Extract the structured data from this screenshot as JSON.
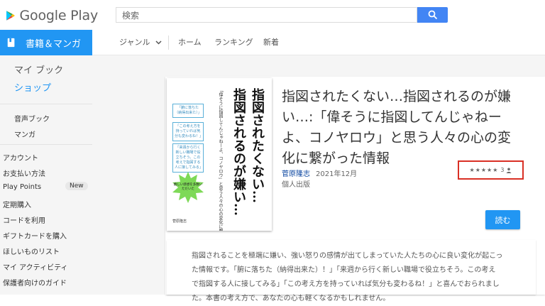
{
  "header": {
    "logo_text": "Google Play",
    "search_placeholder": "検索",
    "colors": {
      "search_button": "#4285f4"
    }
  },
  "category": {
    "label": "書籍＆マンガ",
    "icon": "book-icon",
    "color": "#2196f3"
  },
  "subnav": {
    "genre": "ジャンル",
    "home": "ホーム",
    "ranking": "ランキング",
    "new": "新着"
  },
  "sidebar": {
    "my_book": "マイ ブック",
    "shop": "ショップ",
    "audiobook": "音声ブック",
    "manga": "マンガ",
    "account_items": [
      {
        "label": "アカウント"
      },
      {
        "label": "お支払い方法"
      },
      {
        "label": "Play Points",
        "badge": "New"
      },
      {
        "label": "定期購入"
      },
      {
        "label": "コードを利用"
      },
      {
        "label": "ギフトカードを購入"
      },
      {
        "label": "ほしいものリスト"
      },
      {
        "label": "マイ アクティビティ"
      },
      {
        "label": "保護者向けのガイド"
      }
    ]
  },
  "book": {
    "title": "指図されたくない…指図されるのが嫌い…:「偉そうに指図してんじゃねーよ、コノヤロウ」と思う人々の心の変化に繋がった情報",
    "author": "菅原隆志",
    "date": "2021年12月",
    "publisher": "個人出版",
    "rating_stars": "★★★★★",
    "rating_count": "3",
    "read_button": "読む",
    "cover": {
      "title_line1": "指図されたくない…",
      "title_line2": "指図されるのが嫌い…",
      "subtitle": "「偉そうに指図してんじゃねーよ、コノヤロウ」と思う人々の心の変化に繋がった情報",
      "box1": "「腑に落ちた（納得出来た）」",
      "box2": "「この考え方を持っていれば気分も変わるね！」",
      "box3": "「来週から行く新しい職場で役立ちそう。この考えで指図する人に接してみる」",
      "burst": "嬉しい感想を多数いただいた",
      "publisher": "菅原隆志"
    }
  },
  "description": {
    "lines": [
      "指図されることを極端に嫌い、強い怒りの感情が出てしまっていた人たちの心に良い変化が起こっ",
      "た情報です。「腑に落ちた（納得出来た）！」「来週から行く新しい職場で役立ちそう。この考え",
      "で指図する人に接してみる」「この考え方を持っていれば気分も変わるね！」と喜んでおられまし",
      "た。本書の考え方で、あなたの心も軽くなるかもしれません。"
    ]
  }
}
